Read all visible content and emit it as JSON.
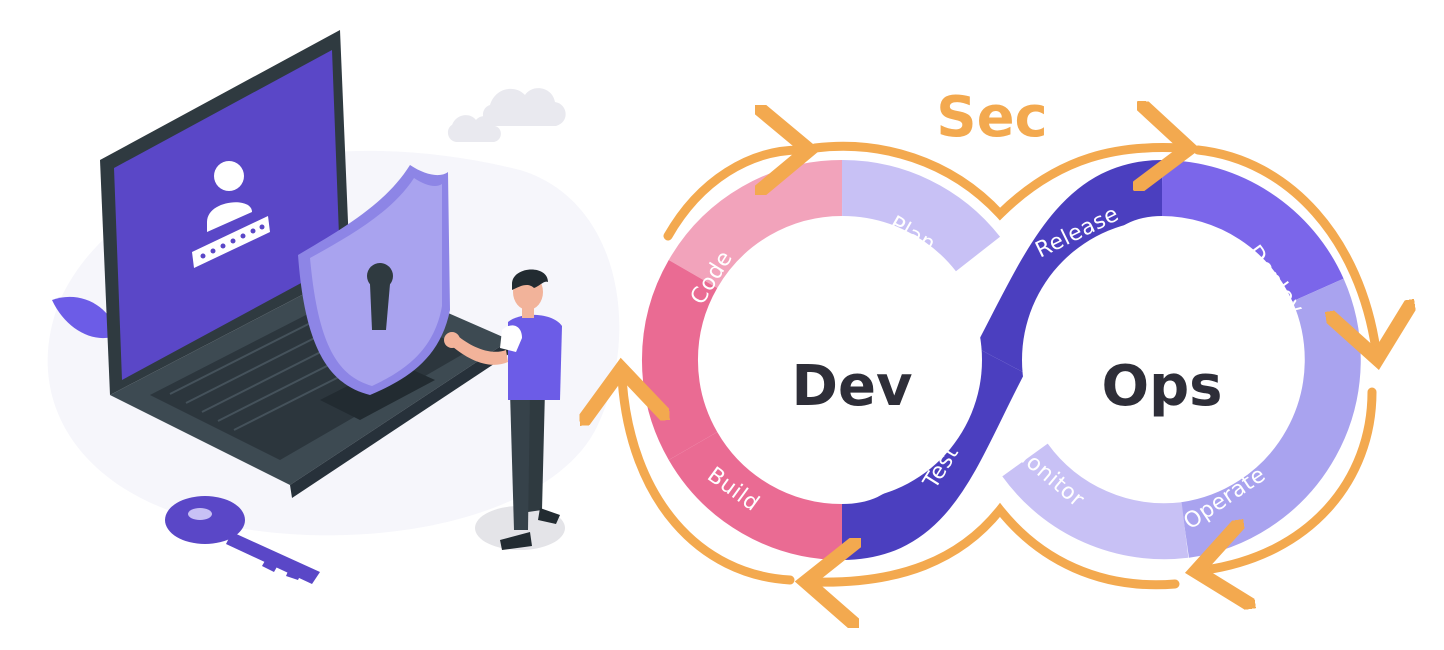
{
  "diagram": {
    "title": "Sec",
    "left_center": "Dev",
    "right_center": "Ops",
    "stages": {
      "plan": "Plan",
      "code": "Code",
      "build": "Build",
      "test": "Test",
      "release": "Release",
      "deploy": "Deploy",
      "operate": "Operate",
      "monitor": "Monitor"
    }
  },
  "colors": {
    "accent_orange": "#f3a94f",
    "violet": "#6c5ce7",
    "dark_indigo": "#4b3fbf",
    "pink": "#ea6b93",
    "light_pink": "#f2a3bb",
    "lavender": "#c8c1f5",
    "periwinkle": "#a9a3ef"
  },
  "icons": {
    "laptop": "laptop-icon",
    "user": "user-icon",
    "shield": "shield-lock-icon",
    "key": "key-icon",
    "person": "person-figure",
    "cloud": "cloud-icon"
  }
}
